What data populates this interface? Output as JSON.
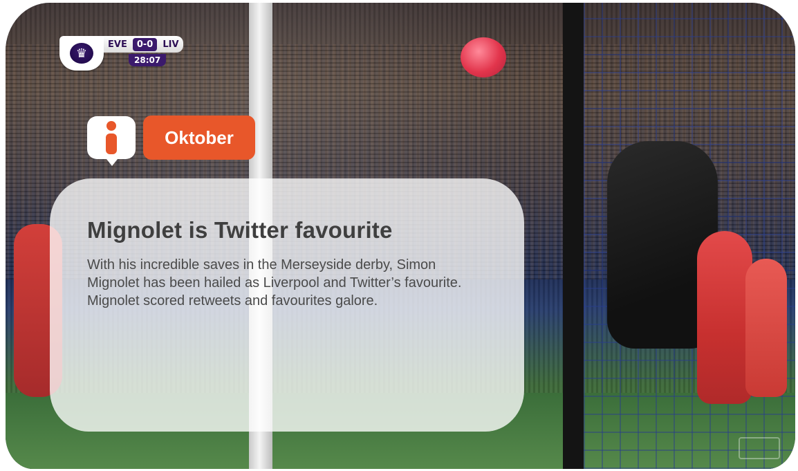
{
  "scoreboard": {
    "home_team": "EVE",
    "score": "0-0",
    "away_team": "LIV",
    "time": "28:07"
  },
  "badge": {
    "icon": "info-icon",
    "month_label": "Oktober"
  },
  "card": {
    "title": "Mignolet is Twitter favourite",
    "body": "With his incredible saves in the Merseyside derby, Simon Mignolet has been hailed as Liverpool and Twitter’s favourite. Mignolet scored retweets and favourites galore."
  },
  "colors": {
    "accent": "#e8572a",
    "card_bg": "#ffffffc7",
    "title_text": "#3f3f3f",
    "body_text": "#4a4a4a"
  }
}
